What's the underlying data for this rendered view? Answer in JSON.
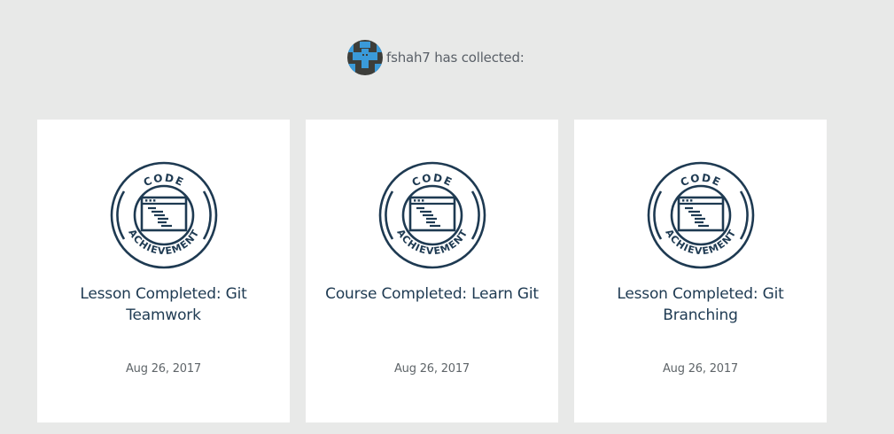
{
  "profile": {
    "username": "fshah7",
    "collected_text": "has collected:"
  },
  "badge": {
    "top_word": "CODE",
    "bottom_word": "ACHIEVEMENT",
    "icon_color": "#1e3a52"
  },
  "achievements": [
    {
      "title": "Lesson Completed: Git Teamwork",
      "date": "Aug 26, 2017"
    },
    {
      "title": "Course Completed: Learn Git",
      "date": "Aug 26, 2017"
    },
    {
      "title": "Lesson Completed: Git Branching",
      "date": "Aug 26, 2017"
    }
  ]
}
